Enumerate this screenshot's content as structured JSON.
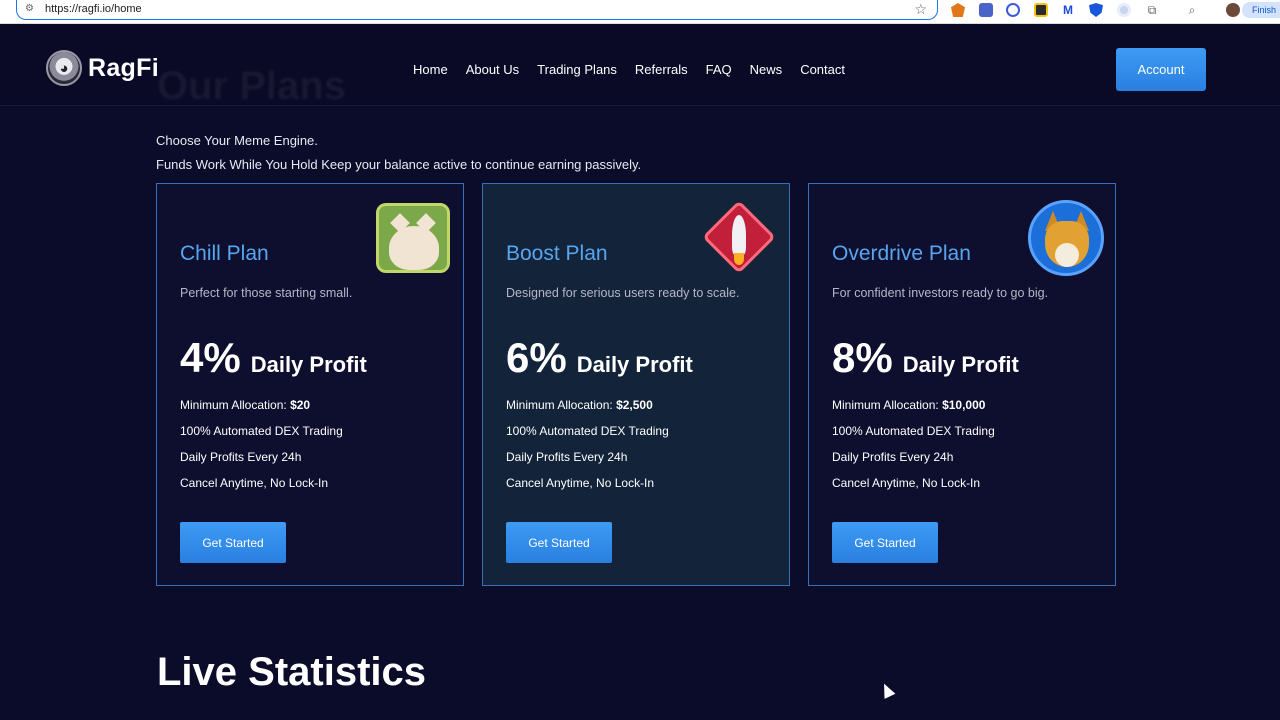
{
  "browser": {
    "url": "https://ragfi.io/home",
    "finish_label": "Finish"
  },
  "nav": {
    "brand": "RagFi",
    "ghost_heading": "Our Plans",
    "links": [
      "Home",
      "About Us",
      "Trading Plans",
      "Referrals",
      "FAQ",
      "News",
      "Contact"
    ],
    "account_label": "Account"
  },
  "intro": {
    "line1": "Choose Your Meme Engine.",
    "line2": "Funds Work While You Hold Keep your balance active to continue earning passively."
  },
  "plans": [
    {
      "title": "Chill Plan",
      "desc": "Perfect for those starting small.",
      "pct": "4%",
      "profit_label": "Daily Profit",
      "min_label": "Minimum Allocation:",
      "min_value": "$20",
      "f1": "100% Automated DEX Trading",
      "f2": "Daily Profits Every 24h",
      "f3": "Cancel Anytime, No Lock-In",
      "button": "Get Started",
      "art": "cat-icon"
    },
    {
      "title": "Boost Plan",
      "desc": "Designed for serious users ready to scale.",
      "pct": "6%",
      "profit_label": "Daily Profit",
      "min_label": "Minimum Allocation:",
      "min_value": "$2,500",
      "f1": "100% Automated DEX Trading",
      "f2": "Daily Profits Every 24h",
      "f3": "Cancel Anytime, No Lock-In",
      "button": "Get Started",
      "art": "rocket-icon"
    },
    {
      "title": "Overdrive Plan",
      "desc": "For confident investors ready to go big.",
      "pct": "8%",
      "profit_label": "Daily Profit",
      "min_label": "Minimum Allocation:",
      "min_value": "$10,000",
      "f1": "100% Automated DEX Trading",
      "f2": "Daily Profits Every 24h",
      "f3": "Cancel Anytime, No Lock-In",
      "button": "Get Started",
      "art": "fox-icon"
    }
  ],
  "stats": {
    "title": "Live Statistics"
  },
  "colors": {
    "accent": "#3d9bf5",
    "title_blue": "#58a6f0",
    "background": "#0b0b2a"
  }
}
